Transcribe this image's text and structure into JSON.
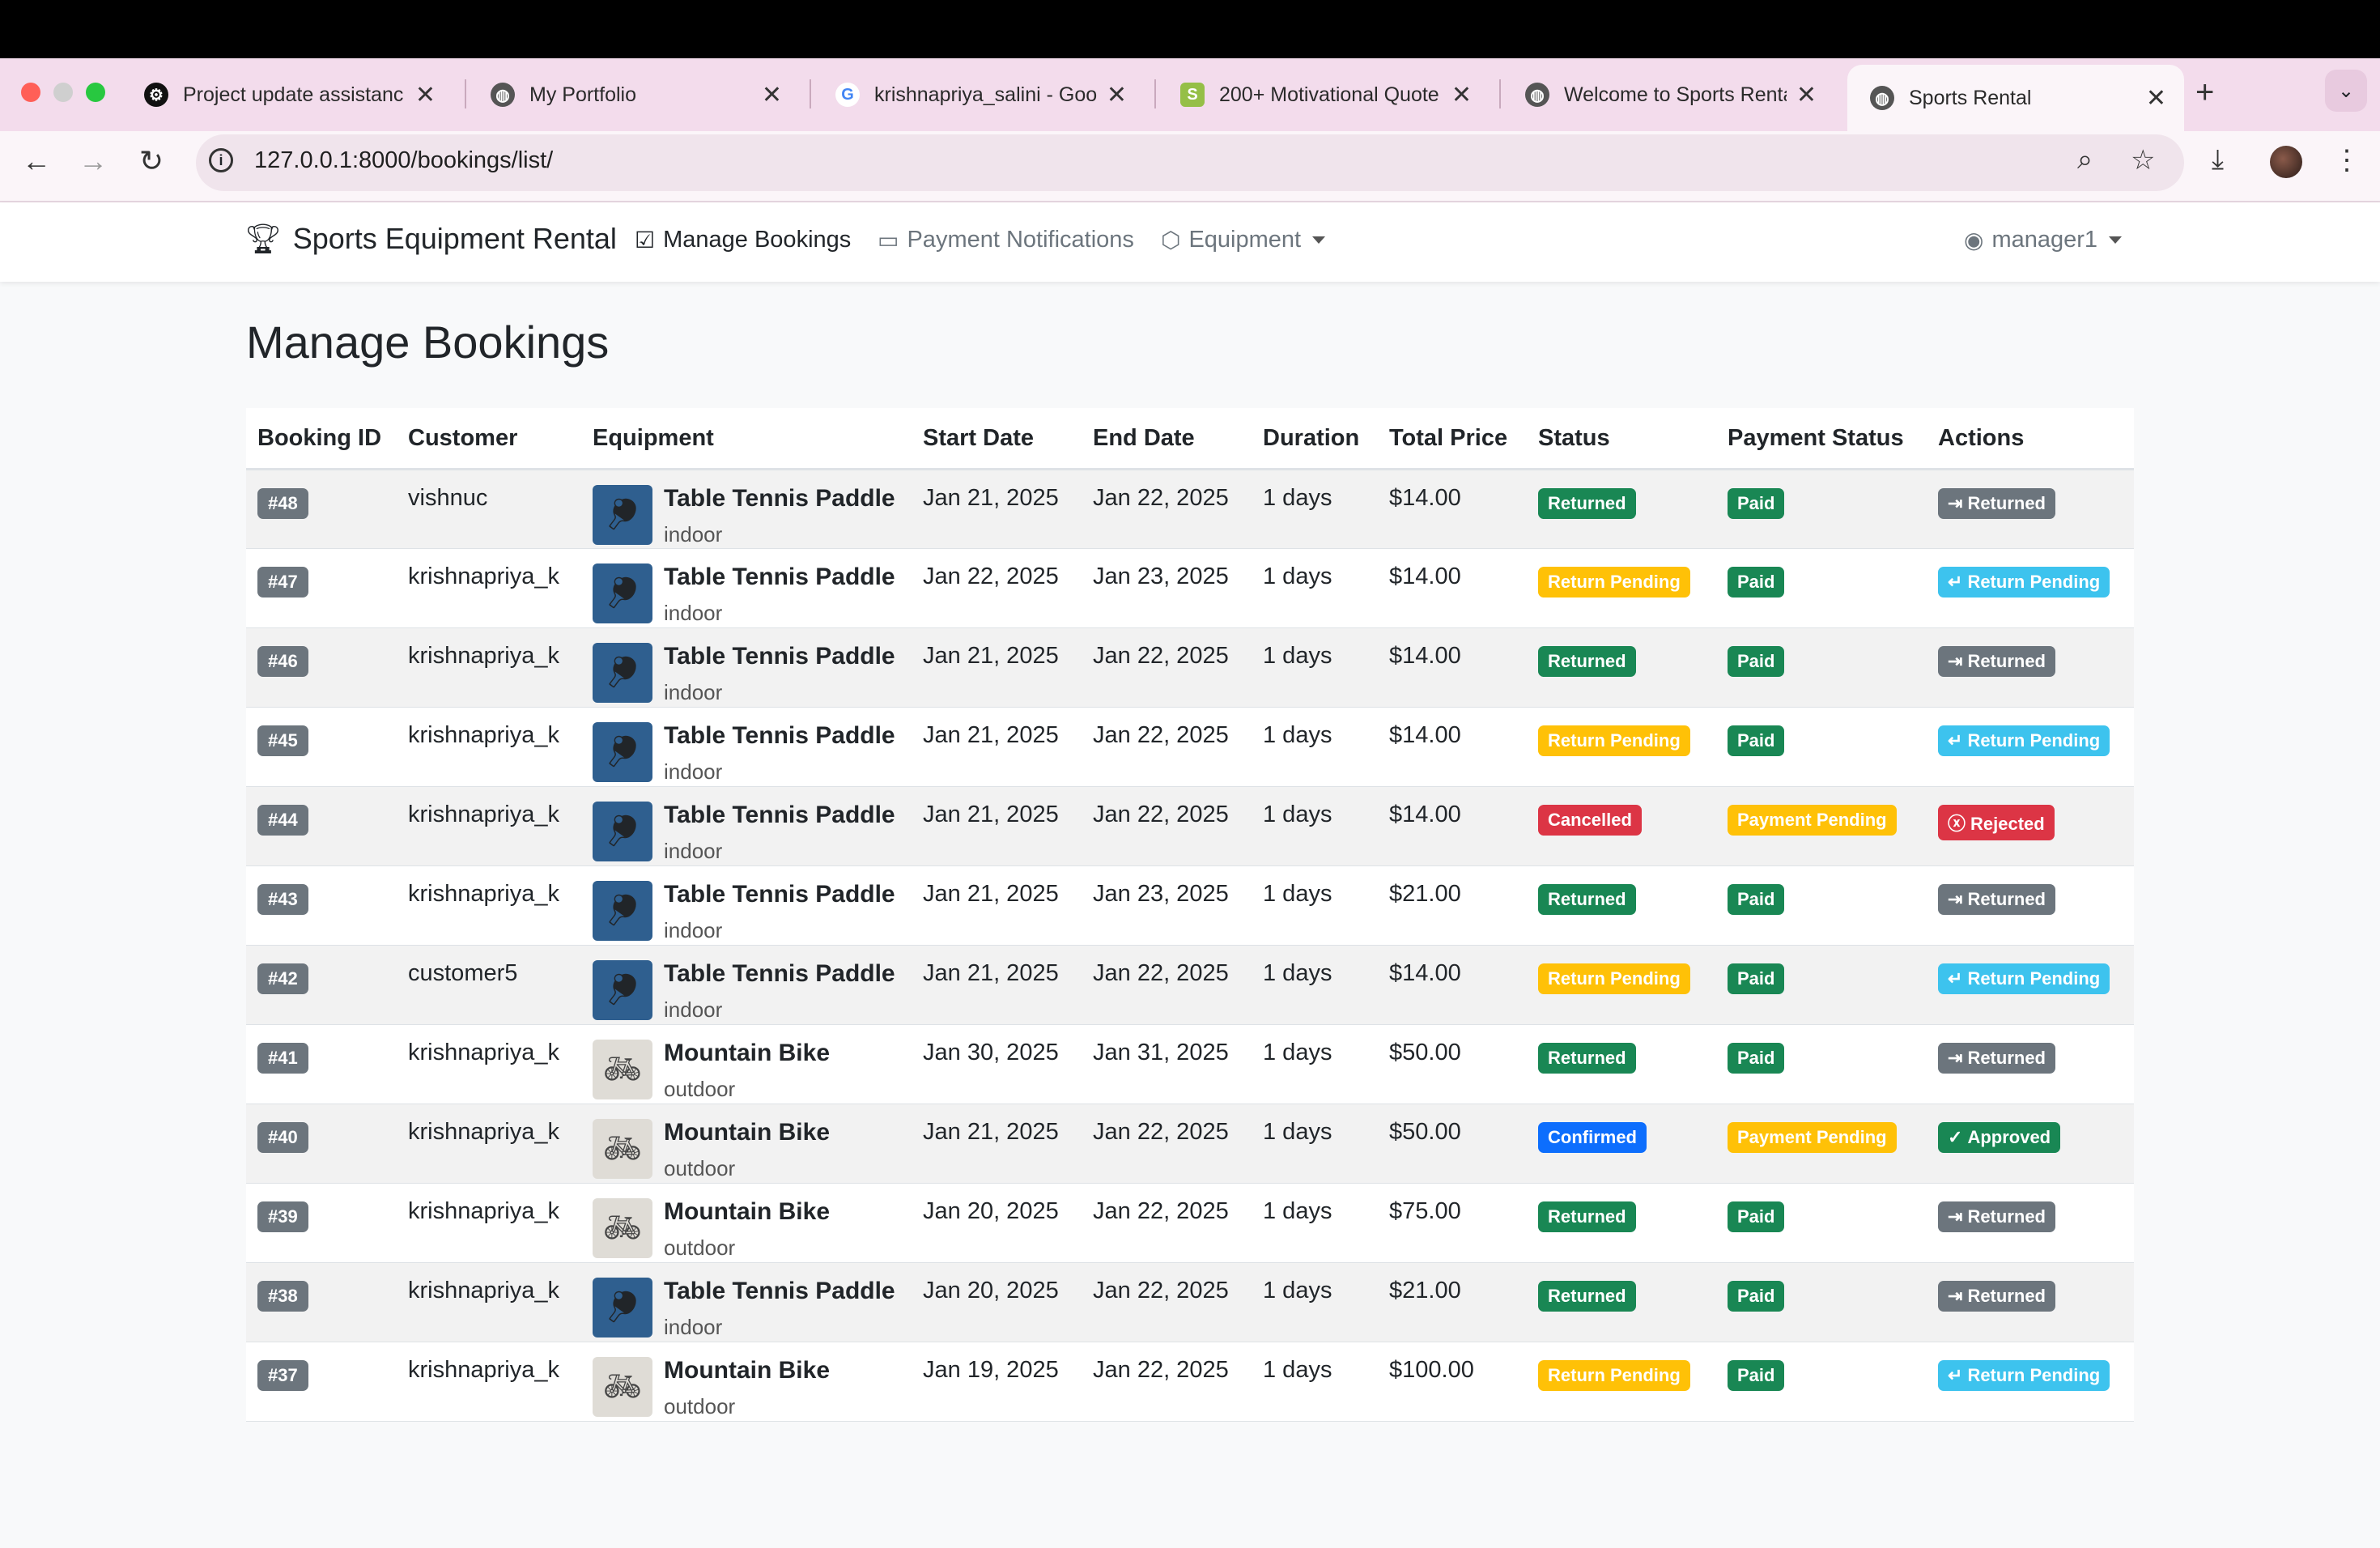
{
  "browser": {
    "tabs": [
      {
        "title": "Project update assistanc",
        "icon": "openai-icon"
      },
      {
        "title": "My Portfolio",
        "icon": "globe-icon"
      },
      {
        "title": "krishnapriya_salini - Goo",
        "icon": "google-icon"
      },
      {
        "title": "200+ Motivational Quote",
        "icon": "shopify-icon"
      },
      {
        "title": "Welcome to Sports Renta",
        "icon": "globe-icon"
      },
      {
        "title": "Sports Rental",
        "icon": "globe-icon",
        "active": true
      }
    ],
    "url": "127.0.0.1:8000/bookings/list/"
  },
  "navbar": {
    "brand": "Sports Equipment Rental",
    "links": {
      "manage_bookings": "Manage Bookings",
      "payment_notifications": "Payment Notifications",
      "equipment": "Equipment"
    },
    "user": "manager1"
  },
  "page": {
    "title": "Manage Bookings"
  },
  "table": {
    "headers": [
      "Booking ID",
      "Customer",
      "Equipment",
      "Start Date",
      "End Date",
      "Duration",
      "Total Price",
      "Status",
      "Payment Status",
      "Actions"
    ],
    "rows": [
      {
        "id": "#48",
        "customer": "vishnuc",
        "equipment": "Table Tennis Paddle",
        "category": "indoor",
        "start": "Jan 21, 2025",
        "end": "Jan 22, 2025",
        "duration": "1 days",
        "price": "$14.00",
        "status": "Returned",
        "payment": "Paid",
        "action": "Returned"
      },
      {
        "id": "#47",
        "customer": "krishnapriya_k",
        "equipment": "Table Tennis Paddle",
        "category": "indoor",
        "start": "Jan 22, 2025",
        "end": "Jan 23, 2025",
        "duration": "1 days",
        "price": "$14.00",
        "status": "Return Pending",
        "payment": "Paid",
        "action": "Return Pending"
      },
      {
        "id": "#46",
        "customer": "krishnapriya_k",
        "equipment": "Table Tennis Paddle",
        "category": "indoor",
        "start": "Jan 21, 2025",
        "end": "Jan 22, 2025",
        "duration": "1 days",
        "price": "$14.00",
        "status": "Returned",
        "payment": "Paid",
        "action": "Returned"
      },
      {
        "id": "#45",
        "customer": "krishnapriya_k",
        "equipment": "Table Tennis Paddle",
        "category": "indoor",
        "start": "Jan 21, 2025",
        "end": "Jan 22, 2025",
        "duration": "1 days",
        "price": "$14.00",
        "status": "Return Pending",
        "payment": "Paid",
        "action": "Return Pending"
      },
      {
        "id": "#44",
        "customer": "krishnapriya_k",
        "equipment": "Table Tennis Paddle",
        "category": "indoor",
        "start": "Jan 21, 2025",
        "end": "Jan 22, 2025",
        "duration": "1 days",
        "price": "$14.00",
        "status": "Cancelled",
        "payment": "Payment Pending",
        "action": "Rejected"
      },
      {
        "id": "#43",
        "customer": "krishnapriya_k",
        "equipment": "Table Tennis Paddle",
        "category": "indoor",
        "start": "Jan 21, 2025",
        "end": "Jan 23, 2025",
        "duration": "1 days",
        "price": "$21.00",
        "status": "Returned",
        "payment": "Paid",
        "action": "Returned"
      },
      {
        "id": "#42",
        "customer": "customer5",
        "equipment": "Table Tennis Paddle",
        "category": "indoor",
        "start": "Jan 21, 2025",
        "end": "Jan 22, 2025",
        "duration": "1 days",
        "price": "$14.00",
        "status": "Return Pending",
        "payment": "Paid",
        "action": "Return Pending"
      },
      {
        "id": "#41",
        "customer": "krishnapriya_k",
        "equipment": "Mountain Bike",
        "category": "outdoor",
        "start": "Jan 30, 2025",
        "end": "Jan 31, 2025",
        "duration": "1 days",
        "price": "$50.00",
        "status": "Returned",
        "payment": "Paid",
        "action": "Returned"
      },
      {
        "id": "#40",
        "customer": "krishnapriya_k",
        "equipment": "Mountain Bike",
        "category": "outdoor",
        "start": "Jan 21, 2025",
        "end": "Jan 22, 2025",
        "duration": "1 days",
        "price": "$50.00",
        "status": "Confirmed",
        "payment": "Payment Pending",
        "action": "Approved"
      },
      {
        "id": "#39",
        "customer": "krishnapriya_k",
        "equipment": "Mountain Bike",
        "category": "outdoor",
        "start": "Jan 20, 2025",
        "end": "Jan 22, 2025",
        "duration": "1 days",
        "price": "$75.00",
        "status": "Returned",
        "payment": "Paid",
        "action": "Returned"
      },
      {
        "id": "#38",
        "customer": "krishnapriya_k",
        "equipment": "Table Tennis Paddle",
        "category": "indoor",
        "start": "Jan 20, 2025",
        "end": "Jan 22, 2025",
        "duration": "1 days",
        "price": "$21.00",
        "status": "Returned",
        "payment": "Paid",
        "action": "Returned"
      },
      {
        "id": "#37",
        "customer": "krishnapriya_k",
        "equipment": "Mountain Bike",
        "category": "outdoor",
        "start": "Jan 19, 2025",
        "end": "Jan 22, 2025",
        "duration": "1 days",
        "price": "$100.00",
        "status": "Return Pending",
        "payment": "Paid",
        "action": "Return Pending"
      }
    ]
  },
  "colors": {
    "returned": "#198754",
    "return_pending": "#ffc107",
    "cancelled": "#dc3545",
    "confirmed": "#0d6efd",
    "action_gray": "#6c757d",
    "action_cyan": "#3dc3ee"
  }
}
